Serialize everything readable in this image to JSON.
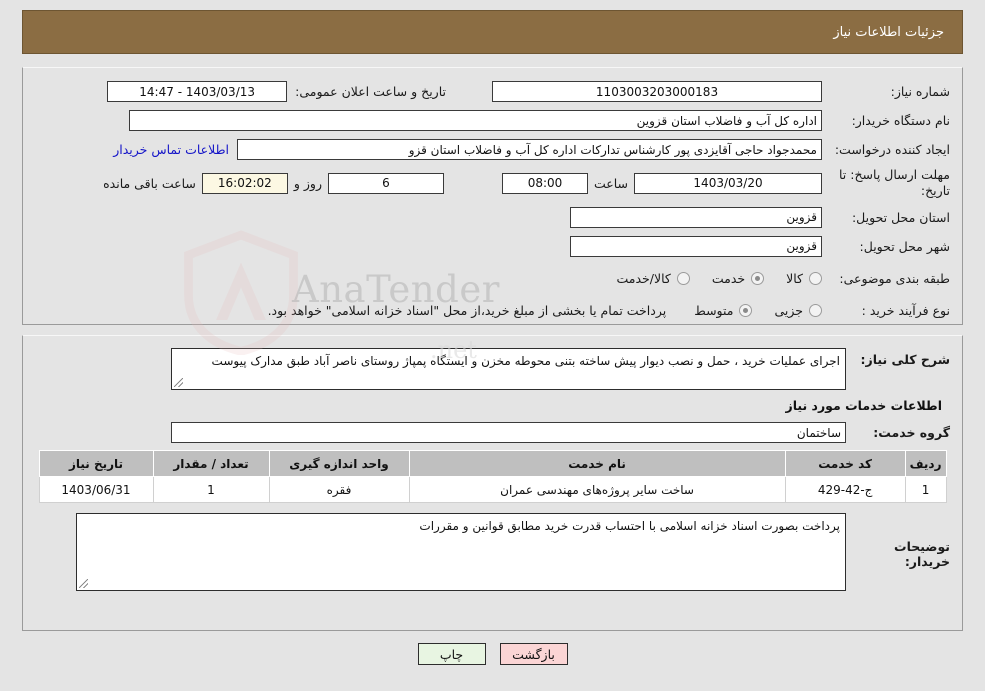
{
  "header": {
    "title": "جزئیات اطلاعات نیاز"
  },
  "need_info": {
    "need_number_label": "شماره نیاز:",
    "need_number_value": "1103003203000183",
    "announce_label": "تاریخ و ساعت اعلان عمومی:",
    "announce_value": "1403/03/13 - 14:47",
    "buyer_org_label": "نام دستگاه خریدار:",
    "buyer_org_value": "اداره کل آب و فاضلاب استان قزوین",
    "creator_label": "ایجاد کننده درخواست:",
    "creator_value": "محمدجواد حاجی آقایزدی پور کارشناس تدارکات اداره کل آب و فاضلاب استان قزو",
    "contact_link": "اطلاعات تماس خریدار",
    "deadline_label": "مهلت ارسال پاسخ: تا تاریخ:",
    "deadline_date": "1403/03/20",
    "hour_word": "ساعت",
    "deadline_time": "08:00",
    "days_remaining": "6",
    "days_word": "روز و",
    "countdown": "16:02:02",
    "remaining_word": "ساعت باقی مانده",
    "province_label": "استان محل تحویل:",
    "province_value": "قزوین",
    "city_label": "شهر محل تحویل:",
    "city_value": "قزوین",
    "category_label": "طبقه بندی موضوعی:",
    "category_options": [
      {
        "label": "کالا",
        "checked": false
      },
      {
        "label": "خدمت",
        "checked": true
      },
      {
        "label": "کالا/خدمت",
        "checked": false
      }
    ],
    "process_label": "نوع فرآیند خرید :",
    "process_options": [
      {
        "label": "جزیی",
        "checked": false
      },
      {
        "label": "متوسط",
        "checked": true
      }
    ],
    "treasury_note": "پرداخت تمام یا بخشی از مبلغ خرید،از محل \"اسناد خزانه اسلامی\" خواهد بود."
  },
  "need_desc": {
    "label": "شرح کلی نیاز:",
    "value": "اجرای عملیات خرید ، حمل و نصب دیوار پیش ساخته بتنی محوطه مخزن و ایستگاه پمپاژ روستای ناصر آباد طبق مدارک پیوست"
  },
  "services": {
    "section_title": "اطلاعات خدمات مورد نیاز",
    "group_label": "گروه خدمت:",
    "group_value": "ساختمان",
    "columns": [
      "ردیف",
      "کد خدمت",
      "نام خدمت",
      "واحد اندازه گیری",
      "تعداد / مقدار",
      "تاریخ نیاز"
    ],
    "rows": [
      {
        "index": "1",
        "code": "ج-42-429",
        "name": "ساخت سایر پروژه‌های مهندسی عمران",
        "unit": "فقره",
        "quantity": "1",
        "need_date": "1403/06/31"
      }
    ]
  },
  "buyer_notes": {
    "label": "توضیحات خریدار:",
    "value": "پرداخت بصورت اسناد خزانه اسلامی با احتساب قدرت خرید مطابق قوانین و مقررات"
  },
  "footer": {
    "print_label": "چاپ",
    "back_label": "بازگشت"
  },
  "watermark": {
    "text": "AnaTender",
    "text2": ".net"
  },
  "colors": {
    "header_bg": "#8b6d43",
    "link": "#1414c8",
    "print_btn": "#e8f5e2",
    "back_btn": "#fbd5d5",
    "countdown_bg": "#fcf8e3",
    "table_header_bg": "#bfbfbf"
  }
}
